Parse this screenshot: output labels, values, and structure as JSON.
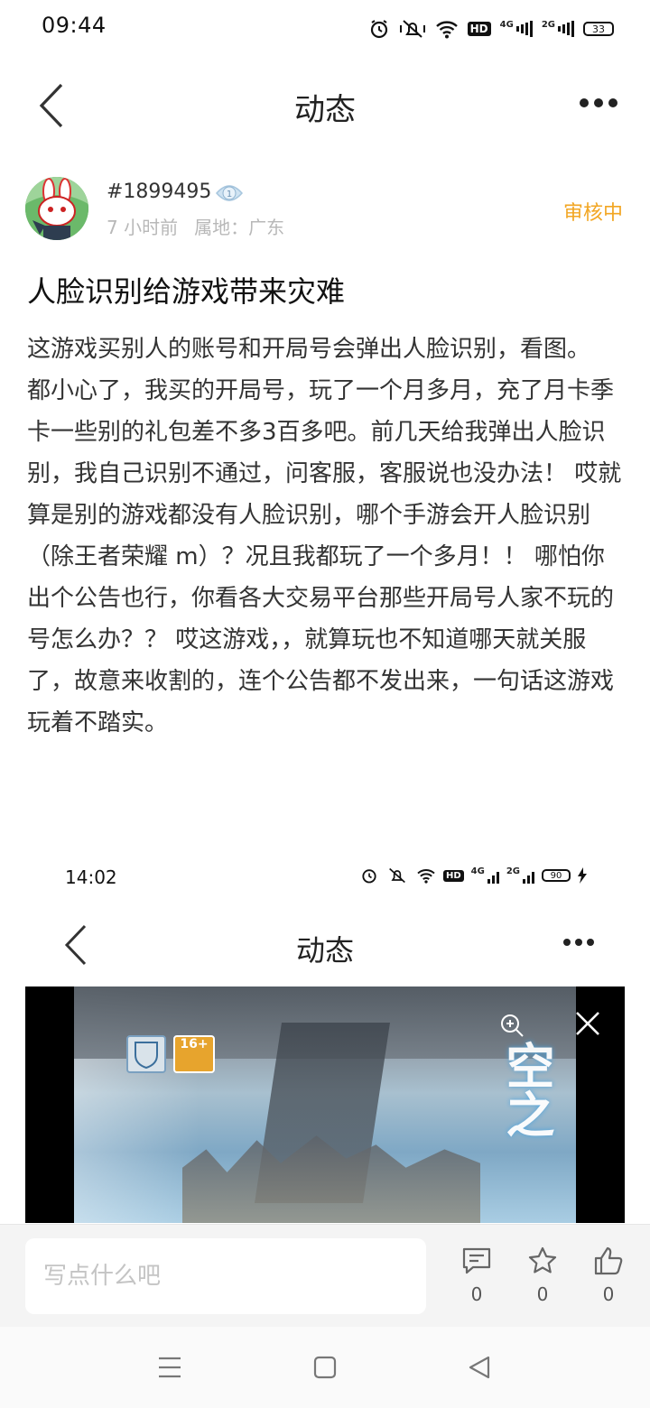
{
  "status_bar": {
    "time": "09:44",
    "battery": "33"
  },
  "header": {
    "title": "动态"
  },
  "author": {
    "name": "#1899495",
    "level": "1",
    "time_ago": "7 小时前",
    "location": "属地：广东"
  },
  "post": {
    "review_status": "审核中",
    "title": "人脸识别给游戏带来灾难",
    "body": "这游戏买别人的账号和开局号会弹出人脸识别，看图。\n都小心了，我买的开局号，玩了一个月多月，充了月卡季卡一些别的礼包差不多3百多吧。前几天给我弹出人脸识别，我自己识别不通过，问客服，客服说也没办法！ 哎就算是别的游戏都没有人脸识别，哪个手游会开人脸识别（除王者荣耀 m）？况且我都玩了一个多月！！ 哪怕你出个公告也行，你看各大交易平台那些开局号人家不玩的号怎么办？？ 哎这游戏，，就算玩也不知道哪天就关服了，故意来收割的，连个公告都不发出来，一句话这游戏玩着不踏实。"
  },
  "embedded_screenshot": {
    "time": "14:02",
    "battery": "90",
    "title": "动态",
    "age_rating": "16+",
    "logo_text": "空之"
  },
  "bottom_bar": {
    "comment_placeholder": "写点什么吧",
    "comment_count": "0",
    "favorite_count": "0",
    "like_count": "0"
  },
  "colors": {
    "review_status": "#f2a623",
    "background": "#ffffff",
    "bottom_bar": "#f4f4f4"
  }
}
